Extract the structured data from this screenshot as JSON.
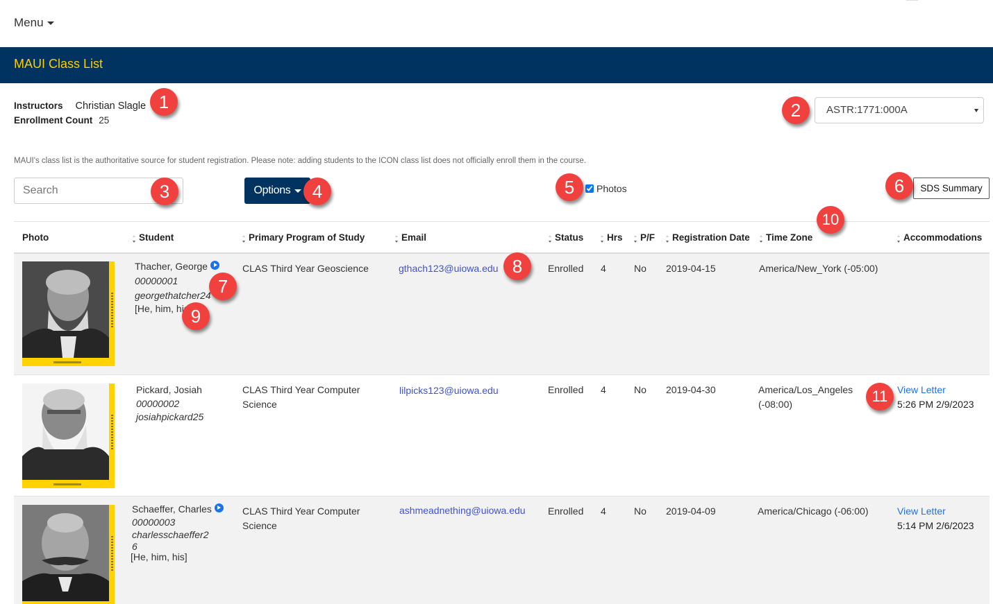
{
  "topbar": {
    "menu_label": "Menu"
  },
  "banner": {
    "title": "MAUI Class List"
  },
  "meta": {
    "instructors_label": "Instructors",
    "instructors_value": "Christian Slagle",
    "enrollment_label": "Enrollment Count",
    "enrollment_value": "25"
  },
  "section_select": {
    "selected": "ASTR:1771:000A"
  },
  "notice": "MAUI's class list is the authoritative source for student registration. Please note: adding students to the ICON class list does not officially enroll them in the course.",
  "toolbar": {
    "search_placeholder": "Search",
    "options_label": "Options",
    "photos_label": "Photos",
    "photos_checked": true,
    "sds_label": "SDS Summary"
  },
  "table": {
    "headers": {
      "photo": "Photo",
      "student": "Student",
      "program": "Primary Program of Study",
      "email": "Email",
      "status": "Status",
      "hrs": "Hrs",
      "pf": "P/F",
      "regdate": "Registration Date",
      "timezone": "Time Zone",
      "accommodations": "Accommodations"
    },
    "rows": [
      {
        "name": "Thacher, George",
        "id": "00000001",
        "username": "georgethatcher24",
        "pronouns": "[He, him, his]",
        "program_line1": "CLAS Third Year Geoscience",
        "program_line2": "",
        "email": "gthach123@uiowa.edu",
        "status": "Enrolled",
        "hrs": "4",
        "pf": "No",
        "regdate": "2019-04-15",
        "timezone_line1": "America/New_York (-05:00)",
        "timezone_line2": "",
        "accommodation_link": "",
        "accommodation_time": ""
      },
      {
        "name": "Pickard, Josiah",
        "id": "00000002",
        "username": "josiahpickard25",
        "pronouns": "",
        "program_line1": "CLAS Third Year Computer",
        "program_line2": "Science",
        "email": "lilpicks123@uiowa.edu",
        "status": "Enrolled",
        "hrs": "4",
        "pf": "No",
        "regdate": "2019-04-30",
        "timezone_line1": "America/Los_Angeles",
        "timezone_line2": "(-08:00)",
        "accommodation_link": "View Letter",
        "accommodation_time": "5:26 PM 2/9/2023"
      },
      {
        "name": "Schaeffer, Charles",
        "id": "00000003",
        "username_line1": "charlesschaeffer2",
        "username_line2": "6",
        "pronouns": "[He, him, his]",
        "program_line1": "CLAS Third Year Computer",
        "program_line2": "Science",
        "email": "ashmeadnething@uiowa.edu",
        "status": "Enrolled",
        "hrs": "4",
        "pf": "No",
        "regdate": "2019-04-09",
        "timezone_line1": "America/Chicago (-06:00)",
        "timezone_line2": "",
        "accommodation_link": "View Letter",
        "accommodation_time": "5:14 PM 2/6/2023"
      }
    ]
  },
  "callouts": [
    "1",
    "2",
    "3",
    "4",
    "5",
    "6",
    "7",
    "8",
    "9",
    "10",
    "11"
  ],
  "colors": {
    "brand_navy": "#00335f",
    "brand_gold": "#ffcd00",
    "callout_red": "#f0413e",
    "link_blue": "#3f51d6"
  }
}
